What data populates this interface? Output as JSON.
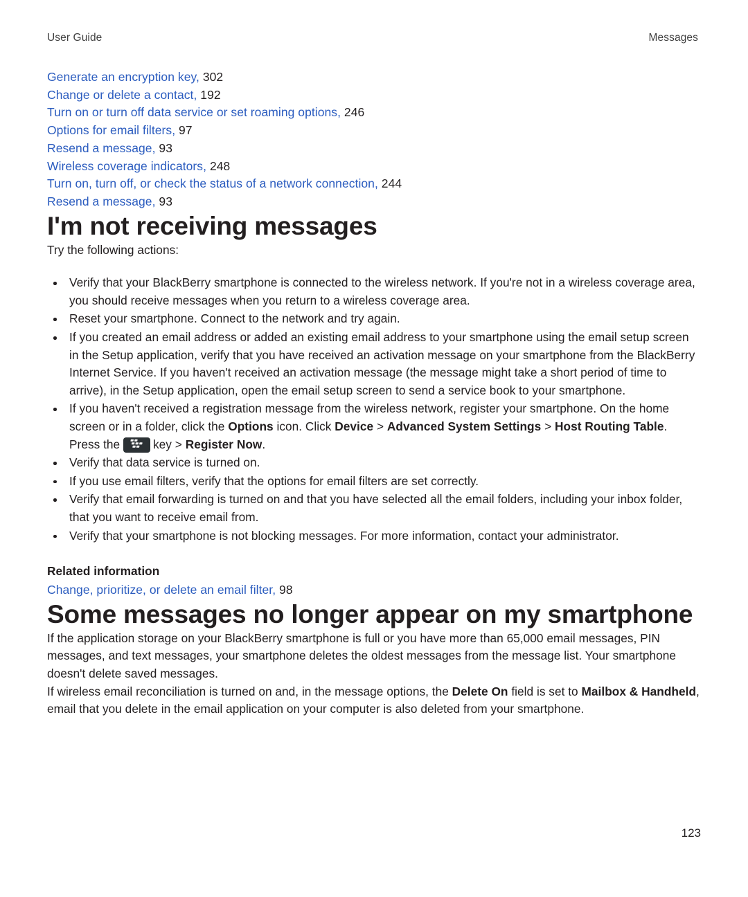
{
  "running_head": {
    "left": "User Guide",
    "right": "Messages"
  },
  "link_list": [
    {
      "text": "Generate an encryption key,",
      "page": "302"
    },
    {
      "text": "Change or delete a contact,",
      "page": "192"
    },
    {
      "text": "Turn on or turn off data service or set roaming options,",
      "page": "246"
    },
    {
      "text": "Options for email filters,",
      "page": "97"
    },
    {
      "text": "Resend a message,",
      "page": "93"
    },
    {
      "text": "Wireless coverage indicators,",
      "page": "248"
    },
    {
      "text": "Turn on, turn off, or check the status of a network connection,",
      "page": "244"
    },
    {
      "text": "Resend a message,",
      "page": "93"
    }
  ],
  "section1": {
    "heading": "I'm not receiving messages",
    "intro": "Try the following actions:",
    "bullets": {
      "b1": "Verify that your BlackBerry smartphone is connected to the wireless network. If you're not in a wireless coverage area, you should receive messages when you return to a wireless coverage area.",
      "b2": "Reset your smartphone. Connect to the network and try again.",
      "b3": "If you created an email address or added an existing email address to your smartphone using the email setup screen in the Setup application, verify that you have received an activation message on your smartphone from the BlackBerry Internet Service. If you haven't received an activation message (the message might take a short period of time to arrive), in the Setup application, open the email setup screen to send a service book to your smartphone.",
      "b4_part1": "If you haven't received a registration message from the wireless network, register your smartphone. On the home screen or in a folder, click the ",
      "b4_options": "Options",
      "b4_part2": " icon. Click ",
      "b4_device": "Device",
      "b4_sep1": " > ",
      "b4_advanced": "Advanced System Settings",
      "b4_sep2": " > ",
      "b4_host": "Host Routing Table",
      "b4_part3": ". Press the ",
      "b4_key_word": "key > ",
      "b4_register": "Register Now",
      "b4_period": ".",
      "b5": "Verify that data service is turned on.",
      "b6": "If you use email filters, verify that the options for email filters are set correctly.",
      "b7": "Verify that email forwarding is turned on and that you have selected all the email folders, including your inbox folder, that you want to receive email from.",
      "b8": "Verify that your smartphone is not blocking messages. For more information, contact your administrator."
    },
    "related_heading": "Related information",
    "related_link": {
      "text": "Change, prioritize, or delete an email filter,",
      "page": "98"
    }
  },
  "section2": {
    "heading": "Some messages no longer appear on my smartphone",
    "para1": "If the application storage on your BlackBerry smartphone is full or you have more than 65,000 email messages, PIN messages, and text messages, your smartphone deletes the oldest messages from the message list. Your smartphone doesn't delete saved messages.",
    "para2_part1": "If wireless email reconciliation is turned on and, in the message options, the ",
    "para2_delete_on": "Delete On",
    "para2_part2": " field is set to ",
    "para2_mailbox": "Mailbox & Handheld",
    "para2_part3": ", email that you delete in the email application on your computer is also deleted from your smartphone."
  },
  "icons": {
    "bb_menu_key": "blackberry-menu-key-icon"
  },
  "folio": "123",
  "colors": {
    "link_blue": "#2b5cbf",
    "text_black": "#231f20",
    "key_dark": "#2b3134"
  }
}
